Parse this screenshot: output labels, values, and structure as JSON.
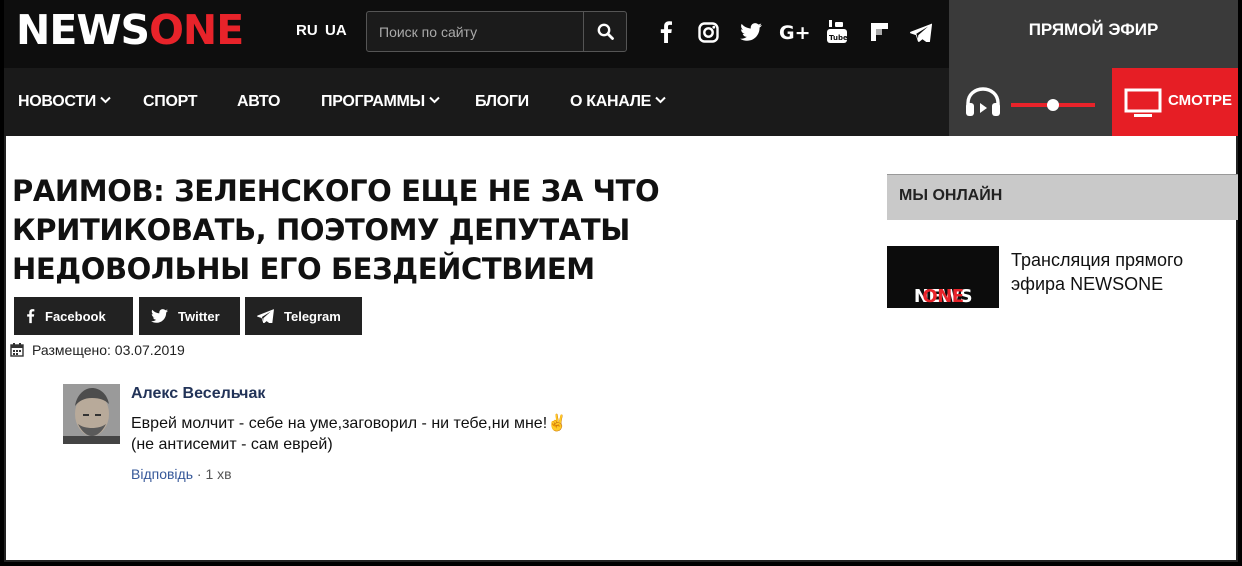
{
  "logo": {
    "part1": "NEWS",
    "part2": "ONE"
  },
  "languages": [
    "RU",
    "UA"
  ],
  "search": {
    "placeholder": "Поиск по сайту"
  },
  "social_icons": [
    "facebook-icon",
    "instagram-icon",
    "twitter-icon",
    "google-plus-icon",
    "youtube-icon",
    "flipboard-icon",
    "telegram-icon"
  ],
  "nav": {
    "items": [
      {
        "label": "НОВОСТИ",
        "has_dropdown": true
      },
      {
        "label": "СПОРТ",
        "has_dropdown": false
      },
      {
        "label": "АВТО",
        "has_dropdown": false
      },
      {
        "label": "ПРОГРАММЫ",
        "has_dropdown": true
      },
      {
        "label": "БЛОГИ",
        "has_dropdown": false
      },
      {
        "label": "О КАНАЛЕ",
        "has_dropdown": true
      }
    ]
  },
  "live": {
    "title": "ПРЯМОЙ ЭФИР",
    "watch_label": "СМОТРЕ",
    "volume_level": 0.5
  },
  "article": {
    "headline": "РАИМОВ: ЗЕЛЕНСКОГО ЕЩЕ НЕ ЗА ЧТО КРИТИКОВАТЬ, ПОЭТОМУ ДЕПУТАТЫ НЕДОВОЛЬНЫ ЕГО БЕЗДЕЙСТВИЕМ",
    "share_buttons": [
      "Facebook",
      "Twitter",
      "Telegram"
    ],
    "posted": "Размещено: 03.07.2019"
  },
  "comment": {
    "author": "Алекс Весельчак",
    "line1": "Еврей молчит - себе на уме,заговорил - ни тебе,ни мне!✌",
    "line2": "(не антисемит - сам еврей)",
    "reply": "Відповідь",
    "separator": " · ",
    "time": "1 хв"
  },
  "sidebar": {
    "heading": "МЫ ОНЛАЙН",
    "thumb_part1": "NEWS",
    "thumb_part2": "ONE",
    "stream_text": "Трансляция прямого эфира NEWSONE"
  },
  "colors": {
    "brand_red": "#e8232a",
    "dark_bar": "#0e0e0e",
    "nav_bar": "#1a1a1a"
  }
}
